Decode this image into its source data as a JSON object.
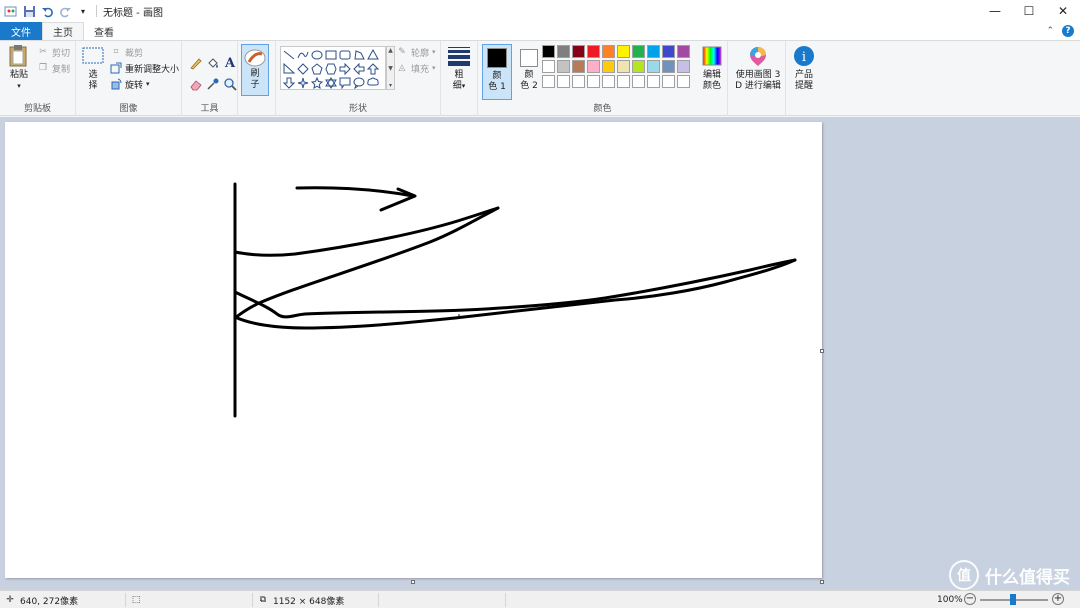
{
  "window": {
    "title": "无标题 - 画图",
    "controls": [
      "minimize-icon",
      "maximize-icon",
      "close-icon"
    ]
  },
  "quick_access": [
    "paint-app-icon",
    "save-icon",
    "undo-icon",
    "redo-icon",
    "customize-icon"
  ],
  "tabs": [
    {
      "label": "文件"
    },
    {
      "label": "主页"
    },
    {
      "label": "查看"
    }
  ],
  "ribbon": {
    "clipboard": {
      "paste_label": "粘贴",
      "cut_label": "剪切",
      "copy_label": "复制",
      "group_label": "剪贴板"
    },
    "image": {
      "select_label_1": "选",
      "select_label_2": "择",
      "crop_label": "裁剪",
      "resize_label": "重新调整大小",
      "rotate_label": "旋转",
      "group_label": "图像"
    },
    "tools": {
      "group_label": "工具",
      "items": [
        "pencil-icon",
        "fill-icon",
        "text-icon",
        "eraser-icon",
        "color-picker-icon",
        "magnifier-icon"
      ]
    },
    "brushes": {
      "label_1": "刷",
      "label_2": "子"
    },
    "shapes": {
      "group_label": "形状",
      "outline_label": "轮廓",
      "fill_label": "填充"
    },
    "size": {
      "label_1": "粗",
      "label_2": "细"
    },
    "colors": {
      "group_label": "颜色",
      "color1_label_1": "颜",
      "color1_label_2": "色 1",
      "color1_value": "#000000",
      "color2_label_1": "颜",
      "color2_label_2": "色 2",
      "color2_value": "#ffffff",
      "edit_label_1": "编辑",
      "edit_label_2": "颜色",
      "palette": [
        "#000000",
        "#7f7f7f",
        "#880015",
        "#ed1c24",
        "#ff7f27",
        "#fff200",
        "#22b14c",
        "#00a2e8",
        "#3f48cc",
        "#a349a4",
        "#ffffff",
        "#c3c3c3",
        "#b97a57",
        "#ffaec9",
        "#ffc90e",
        "#efe4b0",
        "#b5e61d",
        "#99d9ea",
        "#7092be",
        "#c8bfe7",
        "#ffffff",
        "#ffffff",
        "#ffffff",
        "#ffffff",
        "#ffffff",
        "#ffffff",
        "#ffffff",
        "#ffffff",
        "#ffffff",
        "#ffffff"
      ]
    },
    "paint3d": {
      "label_1": "使用画图 3",
      "label_2": "D 进行编辑"
    },
    "product_alert": {
      "label_1": "产品",
      "label_2": "提醒"
    }
  },
  "statusbar": {
    "cursor_pos": "640, 272像素",
    "image_size": "1152 × 648像素",
    "zoom": "100%",
    "zoom_level": 100
  },
  "watermark": {
    "text": "什么值得买",
    "badge": "值"
  }
}
